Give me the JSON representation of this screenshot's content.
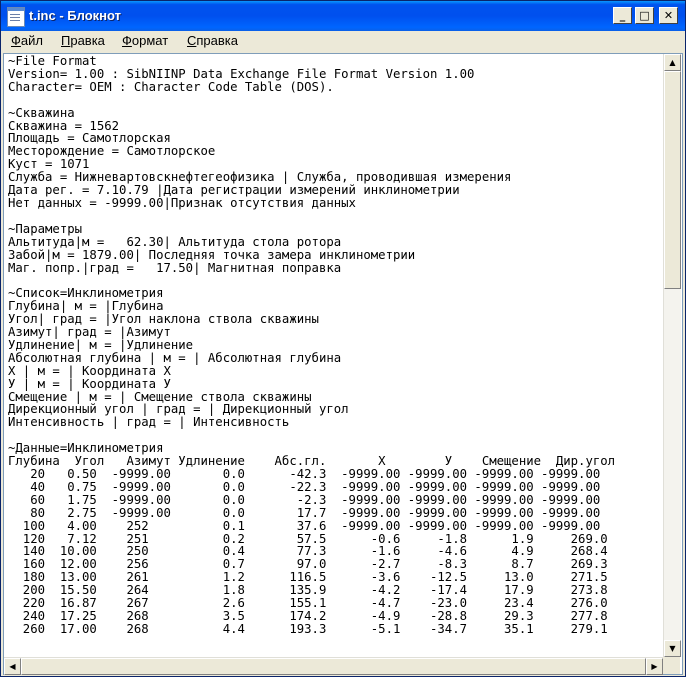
{
  "window": {
    "title": "t.inc - Блокнот",
    "buttons": {
      "minimize": "_",
      "maximize": "□",
      "close": "✕"
    }
  },
  "menu": [
    {
      "label": "Файл"
    },
    {
      "label": "Правка"
    },
    {
      "label": "Формат"
    },
    {
      "label": "Справка"
    }
  ],
  "document": {
    "lines": [
      "~File Format",
      "Version= 1.00 : SibNIINP Data Exchange File Format Version 1.00",
      "Character= OEM : Character Code Table (DOS).",
      "",
      "~Скважина",
      "Скважина = 1562",
      "Площадь = Самотлорская",
      "Месторождение = Самотлорское",
      "Куст = 1071",
      "Служба = Нижневартовскнефтегеофизика | Служба, проводившая измерения",
      "Дата рег. = 7.10.79 |Дата регистрации измерений инклинометрии",
      "Нет данных = -9999.00|Признак отсутствия данных",
      "",
      "~Параметры",
      "Альтитуда|м =   62.30| Альтитуда стола ротора",
      "Забой|м = 1879.00| Последняя точка замера инклинометрии",
      "Маг. попр.|град =   17.50| Магнитная поправка",
      "",
      "~Список=Инклинометрия",
      "Глубина| м = |Глубина",
      "Угол| град = |Угол наклона ствола скважины",
      "Азимут| град = |Азимут",
      "Удлинение| м = |Удлинение",
      "Абсолютная глубина | м = | Абсолютная глубина",
      "X | м = | Координата X",
      "У | м = | Координата У",
      "Смещение | м = | Смещение ствола скважины",
      "Дирекционный угол | град = | Дирекционный угол",
      "Интенсивность | град = | Интенсивность",
      "",
      "~Данные=Инклинометрия",
      "Глубина  Угол   Азимут Удлинение    Абс.гл.       X        У    Смещение  Дир.угол",
      "   20   0.50  -9999.00       0.0      -42.3  -9999.00 -9999.00 -9999.00 -9999.00",
      "   40   0.75  -9999.00       0.0      -22.3  -9999.00 -9999.00 -9999.00 -9999.00",
      "   60   1.75  -9999.00       0.0       -2.3  -9999.00 -9999.00 -9999.00 -9999.00",
      "   80   2.75  -9999.00       0.0       17.7  -9999.00 -9999.00 -9999.00 -9999.00",
      "  100   4.00    252          0.1       37.6  -9999.00 -9999.00 -9999.00 -9999.00",
      "  120   7.12    251          0.2       57.5      -0.6     -1.8      1.9     269.0",
      "  140  10.00    250          0.4       77.3      -1.6     -4.6      4.9     268.4",
      "  160  12.00    256          0.7       97.0      -2.7     -8.3      8.7     269.3",
      "  180  13.00    261          1.2      116.5      -3.6    -12.5     13.0     271.5",
      "  200  15.50    264          1.8      135.9      -4.2    -17.4     17.9     273.8",
      "  220  16.87    267          2.6      155.1      -4.7    -23.0     23.4     276.0",
      "  240  17.25    268          3.5      174.2      -4.9    -28.8     29.3     277.8",
      "  260  17.00    268          4.4      193.3      -5.1    -34.7     35.1     279.1"
    ]
  },
  "scrollbars": {
    "vertical": {
      "up": "▲",
      "down": "▼",
      "position": 0.0
    },
    "horizontal": {
      "left": "◀",
      "right": "▶",
      "position": 0.0
    }
  }
}
